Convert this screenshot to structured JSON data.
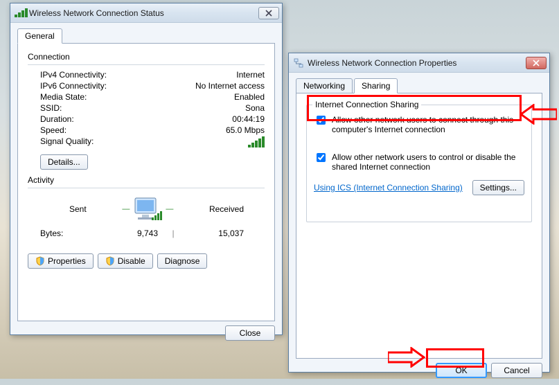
{
  "status_window": {
    "title": "Wireless Network Connection Status",
    "tabs": {
      "general": "General"
    },
    "connection": {
      "heading": "Connection",
      "rows": [
        {
          "k": "IPv4 Connectivity:",
          "v": "Internet"
        },
        {
          "k": "IPv6 Connectivity:",
          "v": "No Internet access"
        },
        {
          "k": "Media State:",
          "v": "Enabled"
        },
        {
          "k": "SSID:",
          "v": "Sona"
        },
        {
          "k": "Duration:",
          "v": "00:44:19"
        },
        {
          "k": "Speed:",
          "v": "65.0 Mbps"
        }
      ],
      "signal_label": "Signal Quality:",
      "details_btn": "Details..."
    },
    "activity": {
      "heading": "Activity",
      "sent_label": "Sent",
      "received_label": "Received",
      "bytes_label": "Bytes:",
      "bytes_sent": "9,743",
      "bytes_received": "15,037"
    },
    "buttons": {
      "properties": "Properties",
      "disable": "Disable",
      "diagnose": "Diagnose",
      "close": "Close"
    }
  },
  "props_window": {
    "title": "Wireless Network Connection Properties",
    "tabs": {
      "networking": "Networking",
      "sharing": "Sharing"
    },
    "group_title": "Internet Connection Sharing",
    "check1": "Allow other network users to connect through this computer's Internet connection",
    "check2": "Allow other network users to control or disable the shared Internet connection",
    "ics_link": "Using ICS (Internet Connection Sharing)",
    "settings_btn": "Settings...",
    "ok_btn": "OK",
    "cancel_btn": "Cancel"
  }
}
